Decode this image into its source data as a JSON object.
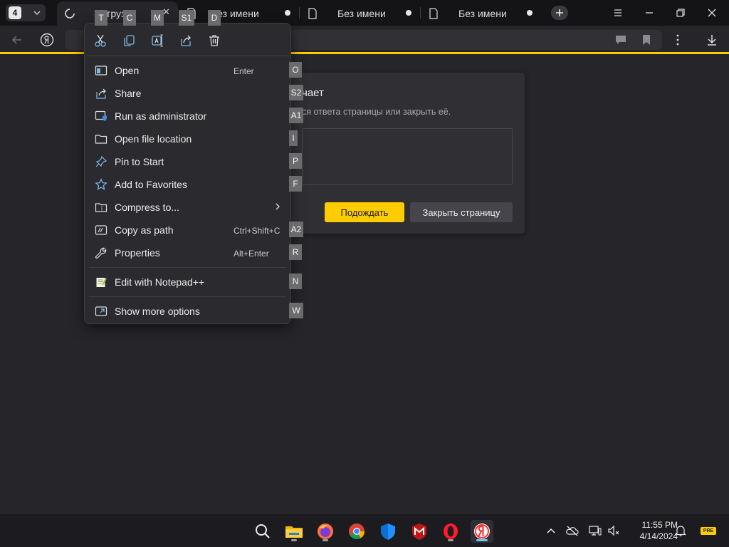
{
  "browser": {
    "tab_count": "4",
    "tabs": [
      {
        "label": "Загруз…",
        "active": true
      },
      {
        "label": "Без имени"
      },
      {
        "label": "Без имени"
      },
      {
        "label": "Без имени"
      }
    ]
  },
  "dialog": {
    "title_fragment": "чает",
    "description_fragment": "ся ответа страницы или закрыть её.",
    "wait_button": "Подождать",
    "close_button": "Закрыть страницу"
  },
  "context_menu": {
    "quick_actions": [
      {
        "icon": "cut-icon",
        "key": "T"
      },
      {
        "icon": "copy-icon",
        "key": "C"
      },
      {
        "icon": "rename-icon",
        "key": "M"
      },
      {
        "icon": "share-icon",
        "key": "S1"
      },
      {
        "icon": "delete-icon",
        "key": "D"
      }
    ],
    "items": [
      {
        "label": "Open",
        "shortcut": "Enter",
        "key": "O",
        "icon": "open-icon"
      },
      {
        "label": "Share",
        "shortcut": "",
        "key": "S2",
        "icon": "share-icon"
      },
      {
        "label": "Run as administrator",
        "shortcut": "",
        "key": "A1",
        "icon": "shield-icon"
      },
      {
        "label": "Open file location",
        "shortcut": "",
        "key": "I",
        "icon": "folder-icon"
      },
      {
        "label": "Pin to Start",
        "shortcut": "",
        "key": "P",
        "icon": "pin-icon"
      },
      {
        "label": "Add to Favorites",
        "shortcut": "",
        "key": "F",
        "icon": "star-icon"
      },
      {
        "label": "Compress to...",
        "shortcut": "",
        "key": "",
        "icon": "archive-icon",
        "submenu": true
      },
      {
        "label": "Copy as path",
        "shortcut": "Ctrl+Shift+C",
        "key": "A2",
        "icon": "path-icon"
      },
      {
        "label": "Properties",
        "shortcut": "Alt+Enter",
        "key": "R",
        "icon": "wrench-icon"
      },
      {
        "label": "Edit with Notepad++",
        "shortcut": "",
        "key": "N",
        "icon": "notepad-icon"
      },
      {
        "label": "Show more options",
        "shortcut": "",
        "key": "W",
        "icon": "more-options-icon"
      }
    ]
  },
  "taskbar": {
    "apps": [
      "search-icon",
      "file-explorer-icon",
      "firefox-icon",
      "chrome-icon",
      "defender-icon",
      "mcafee-icon",
      "opera-icon",
      "yandex-browser-icon"
    ],
    "clock_time": "11:55 PM",
    "clock_date": "4/14/2024",
    "pre_badge": "PRE"
  },
  "colors": {
    "accent": "#ffcc00",
    "menu_bg": "#2b2b2f",
    "page_bg": "#26262a"
  }
}
